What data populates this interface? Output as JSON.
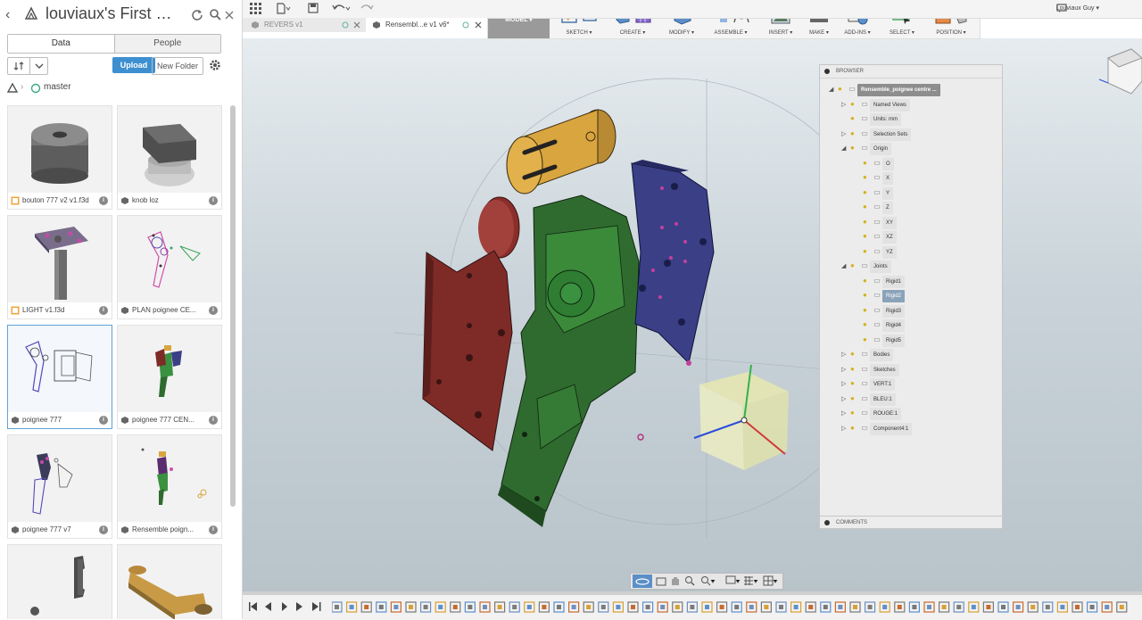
{
  "project": {
    "title": "louviaux's First Pr...",
    "branch": "master"
  },
  "panel_tabs": {
    "data": "Data",
    "people": "People"
  },
  "panel_tools": {
    "upload": "Upload",
    "new_folder": "New Folder"
  },
  "files": [
    {
      "name": "bouton 777 v2 v1.f3d",
      "type": "f3d"
    },
    {
      "name": "knob loz",
      "type": "design"
    },
    {
      "name": "LIGHT v1.f3d",
      "type": "f3d"
    },
    {
      "name": "PLAN poignee CE...",
      "type": "design"
    },
    {
      "name": "poignee 777",
      "type": "design",
      "selected": true
    },
    {
      "name": "poignee 777 CEN...",
      "type": "design"
    },
    {
      "name": "poignee 777 v7",
      "type": "design"
    },
    {
      "name": "Rensemble poign...",
      "type": "design"
    },
    {
      "name": "",
      "type": "design"
    },
    {
      "name": "",
      "type": "design"
    }
  ],
  "doc_tabs": [
    {
      "label": "REVERS v1",
      "active": false
    },
    {
      "label": "Rensembl...e v1 v6*",
      "active": true
    }
  ],
  "ribbon": {
    "workspace": "MODEL ▾",
    "groups": [
      {
        "label": "SKETCH ▾"
      },
      {
        "label": "CREATE ▾"
      },
      {
        "label": "MODIFY ▾"
      },
      {
        "label": "ASSEMBLE ▾"
      },
      {
        "label": "INSERT ▾"
      },
      {
        "label": "MAKE ▾"
      },
      {
        "label": "ADD-INS ▾"
      },
      {
        "label": "SELECT ▾"
      },
      {
        "label": "POSITION ▾"
      }
    ]
  },
  "user": {
    "name": "Louviaux Guy ▾"
  },
  "browser": {
    "title": "BROWSER",
    "comments": "COMMENTS",
    "nodes": [
      {
        "label": "Rensemble_poignee centre ...",
        "level": 0,
        "expanded": true
      },
      {
        "label": "Named Views",
        "level": 1,
        "expanded": false
      },
      {
        "label": "Units: mm",
        "level": 1
      },
      {
        "label": "Selection Sets",
        "level": 1,
        "expanded": false
      },
      {
        "label": "Origin",
        "level": 1,
        "expanded": true
      },
      {
        "label": "O",
        "level": 2
      },
      {
        "label": "X",
        "level": 2
      },
      {
        "label": "Y",
        "level": 2
      },
      {
        "label": "Z",
        "level": 2
      },
      {
        "label": "XY",
        "level": 2
      },
      {
        "label": "XZ",
        "level": 2
      },
      {
        "label": "YZ",
        "level": 2
      },
      {
        "label": "Joints",
        "level": 1,
        "expanded": true
      },
      {
        "label": "Rigid1",
        "level": 2
      },
      {
        "label": "Rigid2",
        "level": 2,
        "selected": true
      },
      {
        "label": "Rigid3",
        "level": 2
      },
      {
        "label": "Rigid4",
        "level": 2
      },
      {
        "label": "Rigid5",
        "level": 2
      },
      {
        "label": "Bodies",
        "level": 1,
        "expanded": false
      },
      {
        "label": "Sketches",
        "level": 1,
        "expanded": false
      },
      {
        "label": "VERT:1",
        "level": 1,
        "expanded": false
      },
      {
        "label": "BLEU:1",
        "level": 1,
        "expanded": false
      },
      {
        "label": "ROUGE:1",
        "level": 1,
        "expanded": false
      },
      {
        "label": "Component4:1",
        "level": 1,
        "expanded": false
      }
    ]
  },
  "colors": {
    "red_part": "#7e2b28",
    "green_part": "#2f6b2f",
    "blue_part": "#3a3f86",
    "yellow_part": "#d9a53f",
    "accent": "#3d8fd0"
  }
}
